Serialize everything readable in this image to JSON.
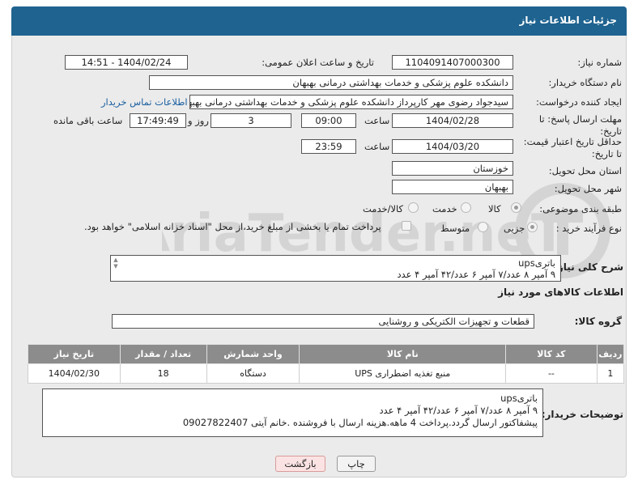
{
  "header": {
    "title": "جزئیات اطلاعات نیاز"
  },
  "fields": {
    "need_number_label": "شماره نیاز:",
    "need_number": "1104091407000300",
    "announce_label": "تاریخ و ساعت اعلان عمومی:",
    "announce_value": "1404/02/24 - 14:51",
    "buyer_org_label": "نام دستگاه خریدار:",
    "buyer_org": "دانشکده علوم پزشکی و خدمات بهداشتی  درمانی بهبهان",
    "requester_label": "ایجاد کننده درخواست:",
    "requester": "سیدجواد رضوی مهر کارپرداز دانشکده علوم پزشکی و خدمات بهداشتی  درمانی بهبهان",
    "contact_link": "اطلاعات تماس خریدار",
    "deadline_label_1": "مهلت ارسال پاسخ: تا",
    "deadline_label_2": "تاریخ:",
    "deadline_date": "1404/02/28",
    "time_label": "ساعت",
    "deadline_time": "09:00",
    "days_value": "3",
    "days_label": "روز و",
    "remaining_time": "17:49:49",
    "remaining_label": "ساعت باقی مانده",
    "price_validity_label_1": "حداقل تاریخ اعتبار قیمت:",
    "price_validity_label_2": "تا تاریخ:",
    "price_validity_date": "1404/03/20",
    "price_validity_time": "23:59",
    "province_label": "استان محل تحویل:",
    "province": "خوزستان",
    "city_label": "شهر محل تحویل:",
    "city": "بهبهان",
    "category_label": "طبقه بندی موضوعی:",
    "category_options": [
      "کالا",
      "خدمت",
      "کالا/خدمت"
    ],
    "process_label": "نوع فرآیند خرید :",
    "process_options": [
      "جزیی",
      "متوسط"
    ],
    "payment_note": "پرداخت تمام یا بخشی از مبلغ خرید،از محل \"اسناد خزانه اسلامی\" خواهد بود."
  },
  "summary": {
    "label": "شرح کلی نیاز:",
    "text": "باتریups\n۹ آمپر ۸ عدد/۷ آمپر ۶ عدد/۴۲ آمپر ۴ عدد"
  },
  "goods": {
    "section_title": "اطلاعات کالاهای مورد نیاز",
    "group_label": "گروه کالا:",
    "group_value": "قطعات و تجهیزات الکتریکی و روشنایی",
    "columns": [
      "ردیف",
      "کد کالا",
      "نام کالا",
      "واحد شمارش",
      "تعداد / مقدار",
      "تاریخ نیاز"
    ],
    "rows": [
      {
        "row": "1",
        "code": "--",
        "name": "منبع تغذیه اضطراری UPS",
        "unit": "دستگاه",
        "qty": "18",
        "date": "1404/02/30"
      }
    ]
  },
  "buyer_notes": {
    "label": "توضیحات خریدار:",
    "text": "باتریups\n۹ آمپر ۸ عدد/۷ آمپر ۶ عدد/۴۲ آمپر ۴ عدد\nپیشفاکتور ارسال گردد.پرداخت 4 ماهه.هزینه ارسال با فروشنده .خانم آیتی 09027822407"
  },
  "buttons": {
    "print": "چاپ",
    "back": "بازگشت"
  },
  "watermark": {
    "text": "AriaTender.neT"
  },
  "colors": {
    "header_bg": "#1f6390",
    "table_header_bg": "#8c8c8c",
    "link": "#1a5fa0",
    "back_button_bg": "#fbe3e3"
  }
}
